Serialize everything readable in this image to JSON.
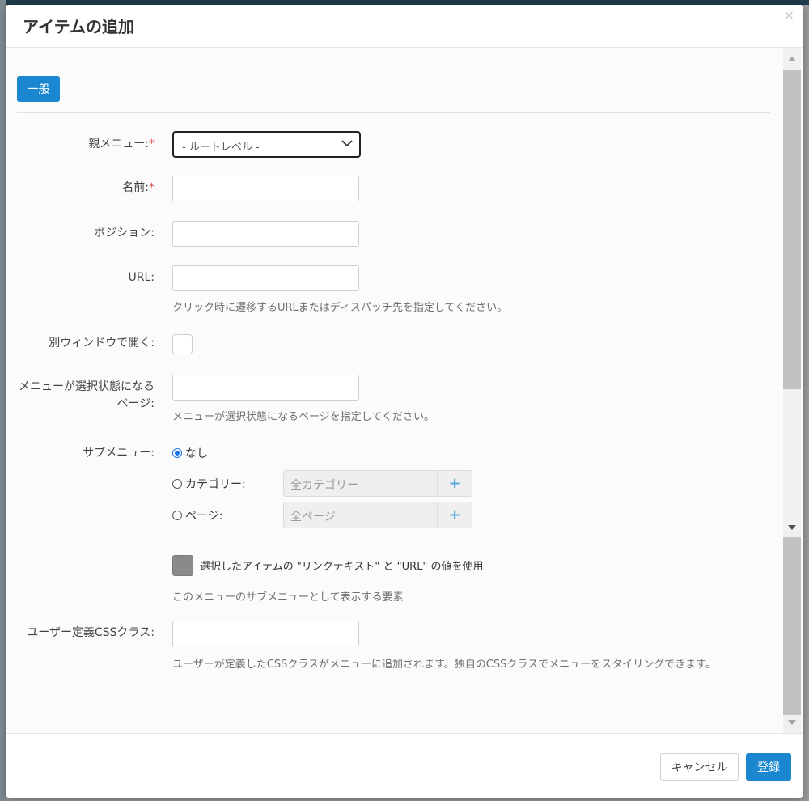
{
  "dialog": {
    "title": "アイテムの追加",
    "close_glyph": "×"
  },
  "tabs": [
    {
      "label": "一般",
      "active": true
    }
  ],
  "form": {
    "parent_menu": {
      "label": "親メニュー:",
      "required_mark": "*",
      "selected": "- ルートレベル -"
    },
    "name": {
      "label": "名前:",
      "required_mark": "*",
      "value": ""
    },
    "position": {
      "label": "ポジション:",
      "value": ""
    },
    "url": {
      "label": "URL:",
      "value": "",
      "help": "クリック時に遷移するURLまたはディスパッチ先を指定してください。"
    },
    "new_window": {
      "label": "別ウィンドウで開く:",
      "checked": false
    },
    "selected_pages": {
      "label_line1": "メニューが選択状態になる",
      "label_line2": "ページ:",
      "value": "",
      "help": "メニューが選択状態になるページを指定してください。"
    },
    "submenu": {
      "label": "サブメニュー:",
      "options": [
        {
          "label": "なし",
          "checked": true
        },
        {
          "label": "カテゴリー:",
          "checked": false,
          "picker_placeholder": "全カテゴリー"
        },
        {
          "label": "ページ:",
          "checked": false,
          "picker_placeholder": "全ページ"
        }
      ],
      "plus_glyph": "+",
      "use_values_text": "選択したアイテムの \"リンクテキスト\" と \"URL\" の値を使用",
      "help": "このメニューのサブメニューとして表示する要素"
    },
    "css_class": {
      "label": "ユーザー定義CSSクラス:",
      "value": "",
      "help": "ユーザーが定義したCSSクラスがメニューに追加されます。独自のCSSクラスでメニューをスタイリングできます。"
    }
  },
  "footer": {
    "cancel_label": "キャンセル",
    "submit_label": "登録"
  },
  "colors": {
    "primary": "#1b87d0",
    "required": "#d9534f",
    "radio_selected": "#1b72e8"
  }
}
